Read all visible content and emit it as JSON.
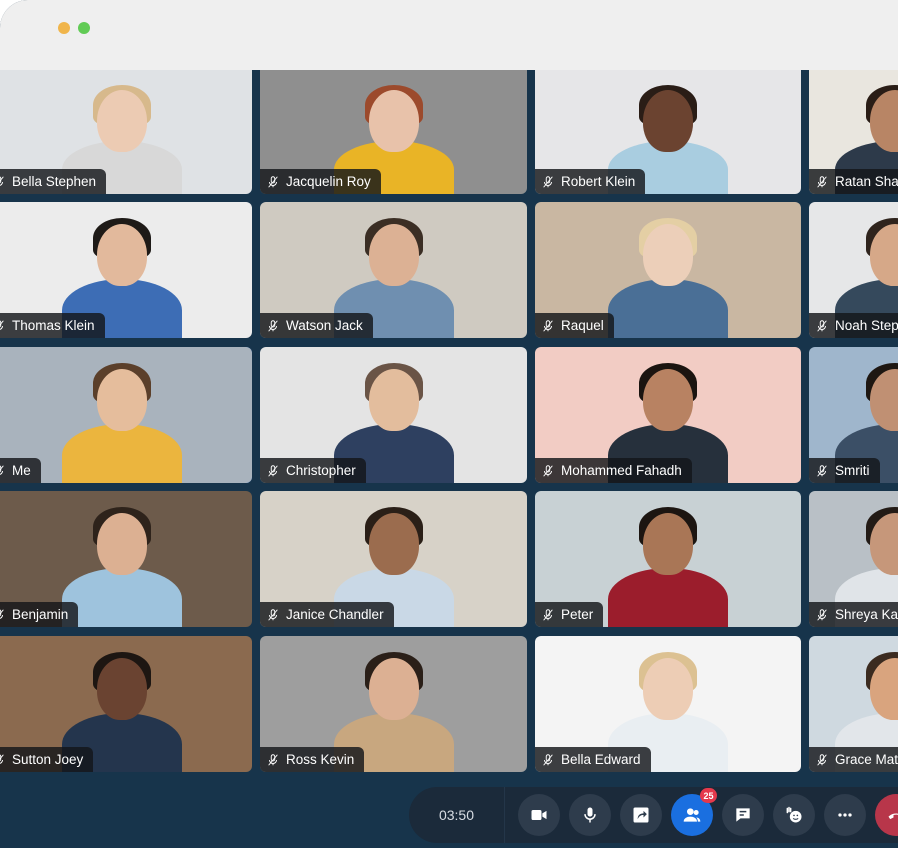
{
  "window": {
    "controls": [
      "minimize",
      "maximize"
    ]
  },
  "call": {
    "timer": "03:50",
    "participants_count": "25"
  },
  "toolbar": {
    "camera_icon": "video-camera-icon",
    "mic_icon": "microphone-icon",
    "share_icon": "share-screen-icon",
    "participants_icon": "participants-icon",
    "chat_icon": "chat-icon",
    "reactions_icon": "raise-hand-icon",
    "more_icon": "more-icon",
    "end_icon": "end-call-icon"
  },
  "participants": [
    {
      "name": "Bella Stephen",
      "muted": true,
      "bg": "#dfe2e5",
      "skin": "#eccbb3",
      "hair": "#d7b98c",
      "shirt": "#d8d8d8"
    },
    {
      "name": "Jacquelin Roy",
      "muted": true,
      "bg": "#8f8f8f",
      "skin": "#e8c2aa",
      "hair": "#9c4a2c",
      "shirt": "#e9b426"
    },
    {
      "name": "Robert Klein",
      "muted": true,
      "bg": "#e6e6e8",
      "skin": "#6b4330",
      "hair": "#2a1d16",
      "shirt": "#a9cde0"
    },
    {
      "name": "Ratan Sharma",
      "muted": true,
      "bg": "#e9e6df",
      "skin": "#b88565",
      "hair": "#2a1d16",
      "shirt": "#2d3a4a"
    },
    {
      "name": "Thomas Klein",
      "muted": true,
      "bg": "#ececec",
      "skin": "#e2b99c",
      "hair": "#1e1a17",
      "shirt": "#3d6db5"
    },
    {
      "name": "Watson Jack",
      "muted": true,
      "bg": "#cfcac1",
      "skin": "#dcb194",
      "hair": "#3b2e24",
      "shirt": "#6f8fb0"
    },
    {
      "name": "Raquel",
      "muted": true,
      "bg": "#c9b7a2",
      "skin": "#eccfb9",
      "hair": "#e4cfa4",
      "shirt": "#4a6f96"
    },
    {
      "name": "Noah Stephen",
      "muted": true,
      "bg": "#e6e7e8",
      "skin": "#d6a888",
      "hair": "#2f241d",
      "shirt": "#35495c"
    },
    {
      "name": "Me",
      "muted": true,
      "active": true,
      "bg": "#a9b3bd",
      "skin": "#e5bd9c",
      "hair": "#5b3f2a",
      "shirt": "#ebb53e"
    },
    {
      "name": "Christopher",
      "muted": true,
      "bg": "#e4e4e4",
      "skin": "#e3bd9d",
      "hair": "#6a5446",
      "shirt": "#2e4060"
    },
    {
      "name": "Mohammed Fahadh",
      "muted": true,
      "bg": "#f2ccc4",
      "skin": "#b88262",
      "hair": "#1b1410",
      "shirt": "#26303c"
    },
    {
      "name": "Smriti",
      "muted": true,
      "bg": "#9fb6cc",
      "skin": "#c09073",
      "hair": "#1e1712",
      "shirt": "#3b4f66"
    },
    {
      "name": "Benjamin",
      "muted": true,
      "bg": "#6d5b4b",
      "skin": "#dcb092",
      "hair": "#2e231b",
      "shirt": "#9ec3dd"
    },
    {
      "name": "Janice Chandler",
      "muted": true,
      "bg": "#d7d2c8",
      "skin": "#9b6c4e",
      "hair": "#2a1f17",
      "shirt": "#c9d8e6"
    },
    {
      "name": "Peter",
      "muted": true,
      "bg": "#c8d1d4",
      "skin": "#a97656",
      "hair": "#1c1511",
      "shirt": "#9b1d2c"
    },
    {
      "name": "Shreya Kapoor",
      "muted": true,
      "bg": "#b9c0c6",
      "skin": "#c6977a",
      "hair": "#231b16",
      "shirt": "#e0e4e8"
    },
    {
      "name": "Sutton Joey",
      "muted": true,
      "bg": "#8b6a4f",
      "skin": "#6a4331",
      "hair": "#1d1612",
      "shirt": "#24354d"
    },
    {
      "name": "Ross Kevin",
      "muted": true,
      "bg": "#9e9e9e",
      "skin": "#dcb093",
      "hair": "#2a1f18",
      "shirt": "#c8a77f"
    },
    {
      "name": "Bella Edward",
      "muted": true,
      "bg": "#f4f4f4",
      "skin": "#edcdb5",
      "hair": "#dcc192",
      "shirt": "#e9eef2"
    },
    {
      "name": "Grace Mathew",
      "muted": true,
      "bg": "#cfd9e0",
      "skin": "#d9a47e",
      "hair": "#3b2b20",
      "shirt": "#e2e6ea"
    }
  ]
}
